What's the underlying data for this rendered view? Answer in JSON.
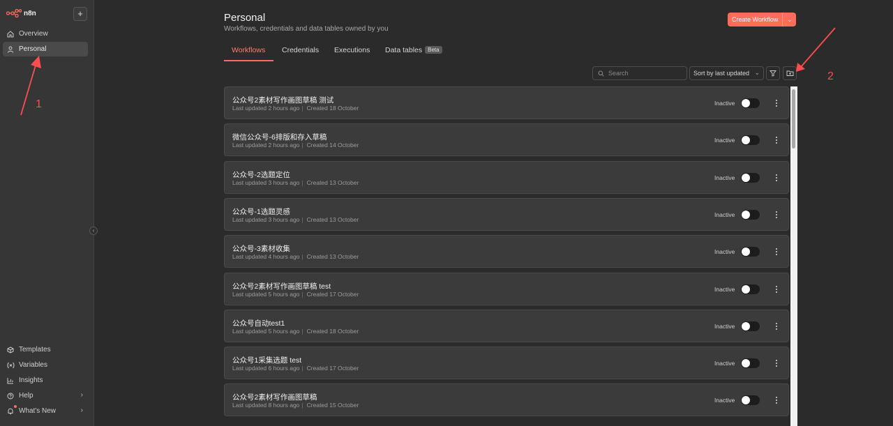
{
  "app": {
    "name": "n8n",
    "new_button": "+"
  },
  "sidebar": {
    "top_items": [
      {
        "label": "Overview",
        "icon": "home-icon"
      },
      {
        "label": "Personal",
        "icon": "user-icon",
        "active": true
      }
    ],
    "bottom_items": [
      {
        "label": "Templates",
        "icon": "package-icon"
      },
      {
        "label": "Variables",
        "icon": "variable-icon"
      },
      {
        "label": "Insights",
        "icon": "chart-icon"
      },
      {
        "label": "Help",
        "icon": "help-icon",
        "has_submenu": true
      },
      {
        "label": "What's New",
        "icon": "bell-icon",
        "has_submenu": true,
        "has_notification": true
      }
    ]
  },
  "header": {
    "title": "Personal",
    "subtitle": "Workflows, credentials and data tables owned by you",
    "create_button": "Create Workflow"
  },
  "tabs": [
    {
      "label": "Workflows",
      "active": true
    },
    {
      "label": "Credentials"
    },
    {
      "label": "Executions"
    },
    {
      "label": "Data tables",
      "badge": "Beta"
    }
  ],
  "toolbar": {
    "search_placeholder": "Search",
    "sort_value": "Sort by last updated"
  },
  "workflows": [
    {
      "name": "公众号2素材写作画图草稿 测试",
      "updated": "Last updated 2 hours ago",
      "created": "Created 18 October",
      "status": "Inactive"
    },
    {
      "name": "微信公众号-6排版和存入草稿",
      "updated": "Last updated 2 hours ago",
      "created": "Created 14 October",
      "status": "Inactive"
    },
    {
      "name": "公众号-2选题定位",
      "updated": "Last updated 3 hours ago",
      "created": "Created 13 October",
      "status": "Inactive"
    },
    {
      "name": "公众号-1选题灵感",
      "updated": "Last updated 3 hours ago",
      "created": "Created 13 October",
      "status": "Inactive"
    },
    {
      "name": "公众号-3素材收集",
      "updated": "Last updated 4 hours ago",
      "created": "Created 13 October",
      "status": "Inactive"
    },
    {
      "name": "公众号2素材写作画图草稿 test",
      "updated": "Last updated 5 hours ago",
      "created": "Created 17 October",
      "status": "Inactive"
    },
    {
      "name": "公众号自动test1",
      "updated": "Last updated 5 hours ago",
      "created": "Created 18 October",
      "status": "Inactive"
    },
    {
      "name": "公众号1采集选题 test",
      "updated": "Last updated 6 hours ago",
      "created": "Created 17 October",
      "status": "Inactive"
    },
    {
      "name": "公众号2素材写作画图草稿",
      "updated": "Last updated 8 hours ago",
      "created": "Created 15 October",
      "status": "Inactive"
    }
  ],
  "annotations": [
    {
      "label": "1"
    },
    {
      "label": "2"
    }
  ],
  "colors": {
    "accent": "#ff6d5a",
    "background": "#2b2b2b",
    "sidebar": "#363636",
    "card": "#3b3b3c",
    "annotation": "#ff4d4d"
  }
}
